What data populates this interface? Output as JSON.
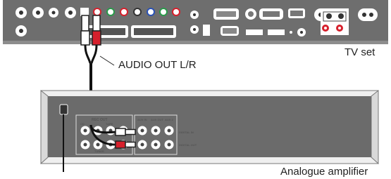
{
  "labels": {
    "audio_out": "AUDIO OUT L/R",
    "tv_set": "TV set",
    "amplifier": "Analogue amplifier"
  },
  "panel_text": {
    "rec_out": "REC OUT",
    "aux_in": "AUX IN",
    "aux_out": "AUX OUT",
    "aux2": "AUX 2",
    "tuner": "TUNER",
    "digital_in": "DIGITAL IN",
    "digital_out": "DIGITAL OUT",
    "cd": "CD",
    "tape": "TAPE",
    "cable_jack": "CD",
    "l": "L",
    "r": "R"
  },
  "colors": {
    "plug_red": "#d6202c",
    "plug_white": "#ffffff",
    "panel": "#6b6b6b"
  }
}
